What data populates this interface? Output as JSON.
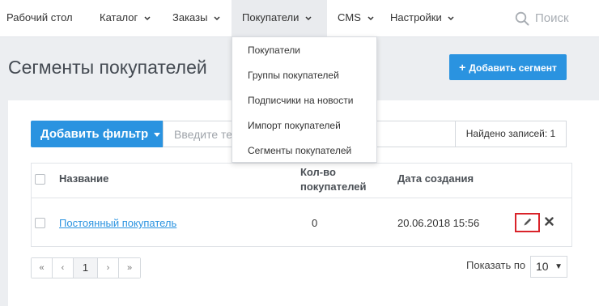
{
  "nav": {
    "items": [
      {
        "label": "Рабочий стол"
      },
      {
        "label": "Каталог"
      },
      {
        "label": "Заказы"
      },
      {
        "label": "Покупатели"
      },
      {
        "label": "CMS"
      },
      {
        "label": "Настройки"
      }
    ],
    "search_placeholder": "Поиск"
  },
  "dropdown": {
    "items": [
      {
        "label": "Покупатели"
      },
      {
        "label": "Группы покупателей"
      },
      {
        "label": "Подписчики на новости"
      },
      {
        "label": "Импорт покупателей"
      },
      {
        "label": "Сегменты покупателей"
      }
    ]
  },
  "page": {
    "title": "Сегменты покупателей",
    "add_button": "Добавить сегмент"
  },
  "filter": {
    "button": "Добавить фильтр",
    "placeholder": "Введите текст для поиска",
    "records": "Найдено записей: 1"
  },
  "table": {
    "headers": {
      "name": "Название",
      "count_line1": "Кол-во",
      "count_line2": "покупателей",
      "date": "Дата создания"
    },
    "rows": [
      {
        "name": "Постоянный покупатель",
        "count": "0",
        "date": "20.06.2018 15:56"
      }
    ]
  },
  "pagination": {
    "first": "«",
    "prev": "‹",
    "current": "1",
    "next": "›",
    "last": "»",
    "per_page_label": "Показать по",
    "per_page_value": "10"
  },
  "colors": {
    "accent": "#2a93e0",
    "highlight_border": "#d9232a"
  }
}
